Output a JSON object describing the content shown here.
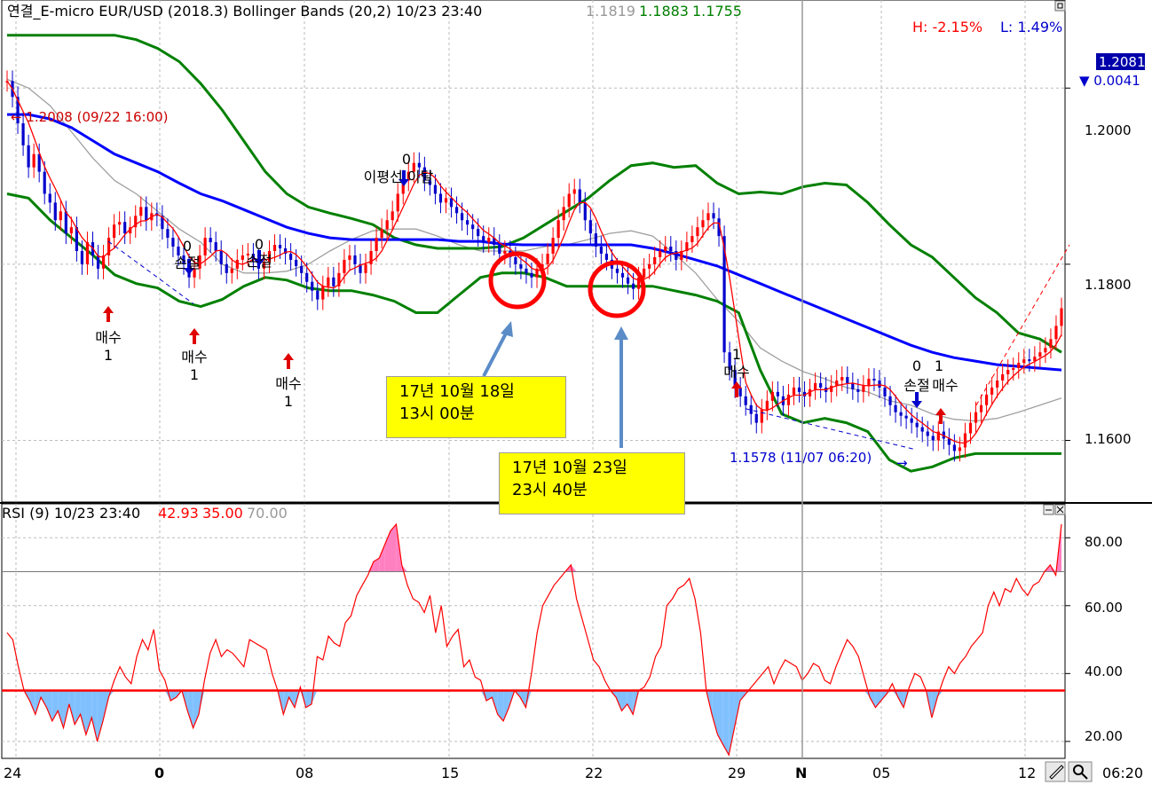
{
  "header": {
    "label": "연결_E-micro EUR/USD (2018.3) Bollinger Bands  (20,2) 10/23 23:40",
    "v1": "1.1819",
    "v2": "1.1883",
    "v3": "1.1755",
    "high": "H: -2.15%",
    "low": "L: 1.49%"
  },
  "price_axis": {
    "ticks": [
      "1.2000",
      "1.1800",
      "1.1600"
    ],
    "last_price": "1.2081",
    "change": "▼ 0.0041"
  },
  "annotations": {
    "high_mark": "← 1.2008 (09/22 16:00)",
    "low_mark": "1.1578 (11/07 06:20)",
    "low_arrow": "→",
    "signals": [
      {
        "top": "",
        "label": "매수",
        "num": "1"
      },
      {
        "top": "0",
        "label": "손절",
        "num": ""
      },
      {
        "top": "",
        "label": "매수",
        "num": "1"
      },
      {
        "top": "0",
        "label": "손절",
        "num": ""
      },
      {
        "top": "",
        "label": "매수",
        "num": "1"
      },
      {
        "top": "0",
        "label": "이평선 이탈",
        "num": ""
      },
      {
        "top": "1",
        "label": "매수",
        "num": ""
      },
      {
        "top": "0",
        "label": "손절",
        "num": ""
      },
      {
        "top": "1",
        "label": "매수",
        "num": ""
      }
    ]
  },
  "notes": [
    {
      "line1": "17년 10월 18일",
      "line2": "13시 00분"
    },
    {
      "line1": "17년 10월 23일",
      "line2": "23시 40분"
    }
  ],
  "rsi_header": {
    "label": "RSI  (9) 10/23 23:40",
    "v1": "42.93",
    "v2": "35.00",
    "v3": "70.00"
  },
  "rsi_axis": {
    "ticks": [
      "80.00",
      "60.00",
      "40.00",
      "20.00"
    ]
  },
  "x_axis": {
    "labels": [
      "24",
      "0",
      "08",
      "15",
      "22",
      "29",
      "N",
      "05",
      "12"
    ],
    "time": "06:20"
  },
  "colors": {
    "candle_up": "#ff0000",
    "candle_down": "#0000cc",
    "bollinger": "#008000",
    "ma_long": "#0000ff",
    "ma_short": "#ff0000",
    "ma_grey": "#a0a0a0",
    "rsi": "#ff0000",
    "rsi_over": "#ff80c0",
    "rsi_under": "#80c0ff",
    "circle": "#ff0000",
    "pointer": "#5b8cc8",
    "note_bg": "#ffff00"
  },
  "chart_data": [
    {
      "type": "candlestick",
      "title": "연결_E-micro EUR/USD (2018.3) Bollinger Bands (20,2)",
      "ylim": [
        1.153,
        1.21
      ],
      "yticks": [
        1.2,
        1.18,
        1.16
      ],
      "x_labels": [
        "24",
        "0",
        "08",
        "15",
        "22",
        "29",
        "N",
        "05",
        "12"
      ],
      "close": [
        1.2008,
        1.199,
        1.196,
        1.1935,
        1.191,
        1.1925,
        1.1905,
        1.188,
        1.187,
        1.185,
        1.186,
        1.1835,
        1.1842,
        1.1815,
        1.18,
        1.1825,
        1.181,
        1.1795,
        1.181,
        1.183,
        1.1845,
        1.1848,
        1.1835,
        1.1842,
        1.1855,
        1.1865,
        1.185,
        1.1858,
        1.1855,
        1.184,
        1.183,
        1.182,
        1.181,
        1.18,
        1.1785,
        1.1795,
        1.181,
        1.183,
        1.1825,
        1.1815,
        1.18,
        1.179,
        1.1795,
        1.1805,
        1.181,
        1.1812,
        1.1805,
        1.1795,
        1.1802,
        1.1815,
        1.1822,
        1.1818,
        1.1812,
        1.1805,
        1.1798,
        1.179,
        1.178,
        1.177,
        1.176,
        1.1775,
        1.1785,
        1.1775,
        1.179,
        1.1805,
        1.181,
        1.18,
        1.179,
        1.18,
        1.1815,
        1.183,
        1.184,
        1.185,
        1.186,
        1.188,
        1.1895,
        1.1905,
        1.1915,
        1.191,
        1.1895,
        1.189,
        1.188,
        1.187,
        1.1875,
        1.1865,
        1.1858,
        1.185,
        1.1845,
        1.184,
        1.1832,
        1.1825,
        1.183,
        1.1822,
        1.1812,
        1.1815,
        1.1808,
        1.18,
        1.1795,
        1.179,
        1.1785,
        1.1795,
        1.18,
        1.1812,
        1.183,
        1.185,
        1.1865,
        1.188,
        1.1885,
        1.187,
        1.185,
        1.1835,
        1.182,
        1.1812,
        1.1805,
        1.1795,
        1.179,
        1.1785,
        1.1778,
        1.1772,
        1.1785,
        1.1795,
        1.18,
        1.1808,
        1.1815,
        1.182,
        1.1815,
        1.1805,
        1.1815,
        1.1825,
        1.1832,
        1.1842,
        1.185,
        1.1858,
        1.1852,
        1.1832,
        1.17,
        1.168,
        1.166,
        1.165,
        1.164,
        1.163,
        1.162,
        1.1635,
        1.1645,
        1.1655,
        1.165,
        1.164,
        1.1652,
        1.166,
        1.1655,
        1.165,
        1.1658,
        1.1665,
        1.166,
        1.1655,
        1.1662,
        1.1668,
        1.1672,
        1.1665,
        1.1658,
        1.1655,
        1.1662,
        1.167,
        1.1668,
        1.166,
        1.165,
        1.164,
        1.1632,
        1.1628,
        1.1625,
        1.162,
        1.1615,
        1.161,
        1.1605,
        1.16,
        1.161,
        1.1602,
        1.1595,
        1.1588,
        1.1592,
        1.1608,
        1.162,
        1.1632,
        1.164,
        1.1652,
        1.166,
        1.1668,
        1.1675,
        1.168,
        1.1682,
        1.1688,
        1.1692,
        1.169,
        1.1695,
        1.17,
        1.1705,
        1.1715,
        1.173,
        1.175
      ],
      "bollinger_upper": [
        1.206,
        1.206,
        1.206,
        1.206,
        1.206,
        1.206,
        1.2055,
        1.2045,
        1.203,
        1.2005,
        1.1975,
        1.194,
        1.1905,
        1.188,
        1.1865,
        1.1858,
        1.1852,
        1.1845,
        1.183,
        1.1822,
        1.1818,
        1.1818,
        1.1818,
        1.182,
        1.183,
        1.1845,
        1.186,
        1.1875,
        1.1895,
        1.1912,
        1.1915,
        1.191,
        1.1912,
        1.1892,
        1.188,
        1.1882,
        1.188,
        1.1888,
        1.1892,
        1.189,
        1.187,
        1.1845,
        1.1822,
        1.1808,
        1.1785,
        1.1762,
        1.1745,
        1.1722,
        1.1715,
        1.17
      ],
      "bollinger_middle": [
        1.197,
        1.197,
        1.1965,
        1.1955,
        1.194,
        1.1925,
        1.1915,
        1.1905,
        1.1892,
        1.188,
        1.1872,
        1.1862,
        1.1852,
        1.1842,
        1.1835,
        1.183,
        1.1828,
        1.1828,
        1.1828,
        1.1828,
        1.1828,
        1.1826,
        1.1826,
        1.1823,
        1.1822,
        1.1822,
        1.1822,
        1.1822,
        1.1822,
        1.1822,
        1.1818,
        1.1812,
        1.1805,
        1.1798,
        1.1788,
        1.1778,
        1.1768,
        1.1758,
        1.1748,
        1.1738,
        1.1728,
        1.1718,
        1.1708,
        1.17,
        1.1694,
        1.169,
        1.1686,
        1.1684,
        1.1682,
        1.168
      ],
      "bollinger_lower": [
        1.188,
        1.1875,
        1.185,
        1.183,
        1.181,
        1.1788,
        1.1778,
        1.1773,
        1.1758,
        1.1752,
        1.176,
        1.1775,
        1.1785,
        1.1782,
        1.1773,
        1.177,
        1.177,
        1.1765,
        1.1758,
        1.1745,
        1.1745,
        1.1765,
        1.1785,
        1.179,
        1.179,
        1.1785,
        1.1775,
        1.1775,
        1.1775,
        1.1775,
        1.1775,
        1.177,
        1.1765,
        1.1758,
        1.1745,
        1.168,
        1.163,
        1.162,
        1.1625,
        1.162,
        1.161,
        1.1578,
        1.1565,
        1.157,
        1.158,
        1.1585,
        1.1585,
        1.1585,
        1.1585,
        1.1585
      ],
      "ma_grey": [
        1.201,
        1.2,
        1.198,
        1.195,
        1.192,
        1.1895,
        1.188,
        1.186,
        1.184,
        1.1825,
        1.18,
        1.179,
        1.179,
        1.1792,
        1.18,
        1.1815,
        1.1828,
        1.1838,
        1.184,
        1.184,
        1.1832,
        1.1822,
        1.1815,
        1.1815,
        1.1815,
        1.182,
        1.1822,
        1.1828,
        1.1835,
        1.1838,
        1.1832,
        1.1812,
        1.179,
        1.176,
        1.1735,
        1.1705,
        1.169,
        1.1678,
        1.167,
        1.166,
        1.1655,
        1.1645,
        1.164,
        1.163,
        1.1624,
        1.1622,
        1.1625,
        1.1632,
        1.164,
        1.1648
      ]
    },
    {
      "type": "line",
      "title": "RSI (9)",
      "ylim": [
        15,
        90
      ],
      "yticks": [
        80,
        60,
        40,
        20
      ],
      "reference_lines": [
        35,
        70
      ],
      "values": [
        52,
        50,
        42,
        35,
        32,
        28,
        33,
        30,
        26,
        29,
        24,
        31,
        25,
        28,
        22,
        27,
        20,
        26,
        33,
        38,
        42,
        39,
        37,
        45,
        50,
        47,
        53,
        41,
        38,
        32,
        33,
        35,
        29,
        24,
        28,
        38,
        46,
        50,
        45,
        47,
        46,
        44,
        42,
        50,
        49,
        48,
        47,
        40,
        35,
        28,
        33,
        30,
        36,
        30,
        31,
        45,
        44,
        51,
        49,
        48,
        55,
        57,
        63,
        66,
        69,
        73,
        74,
        78,
        82,
        84,
        72,
        66,
        62,
        61,
        58,
        63,
        52,
        60,
        48,
        51,
        53,
        42,
        44,
        39,
        38,
        32,
        33,
        28,
        26,
        30,
        35,
        33,
        30,
        40,
        52,
        60,
        63,
        66,
        68,
        70,
        72,
        62,
        56,
        50,
        44,
        42,
        38,
        35,
        33,
        29,
        31,
        28,
        35,
        36,
        39,
        45,
        48,
        60,
        62,
        65,
        66,
        68,
        62,
        52,
        35,
        28,
        22,
        19,
        16,
        24,
        32,
        34,
        36,
        38,
        40,
        42,
        37,
        41,
        44,
        43,
        42,
        38,
        40,
        43,
        42,
        38,
        37,
        42,
        46,
        50,
        48,
        45,
        39,
        33,
        30,
        32,
        34,
        37,
        33,
        30,
        36,
        40,
        39,
        35,
        27,
        33,
        38,
        42,
        40,
        43,
        45,
        48,
        50,
        52,
        60,
        64,
        60,
        65,
        64,
        68,
        65,
        63,
        66,
        67,
        70,
        72,
        69,
        84
      ]
    }
  ]
}
